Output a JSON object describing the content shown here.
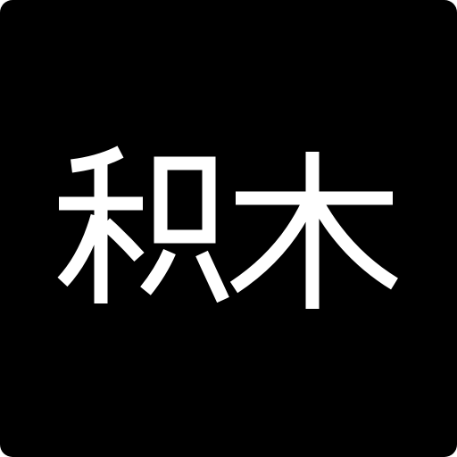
{
  "logo": {
    "text": "积木",
    "background_color": "#000000",
    "glyph_color": "#ffffff"
  }
}
